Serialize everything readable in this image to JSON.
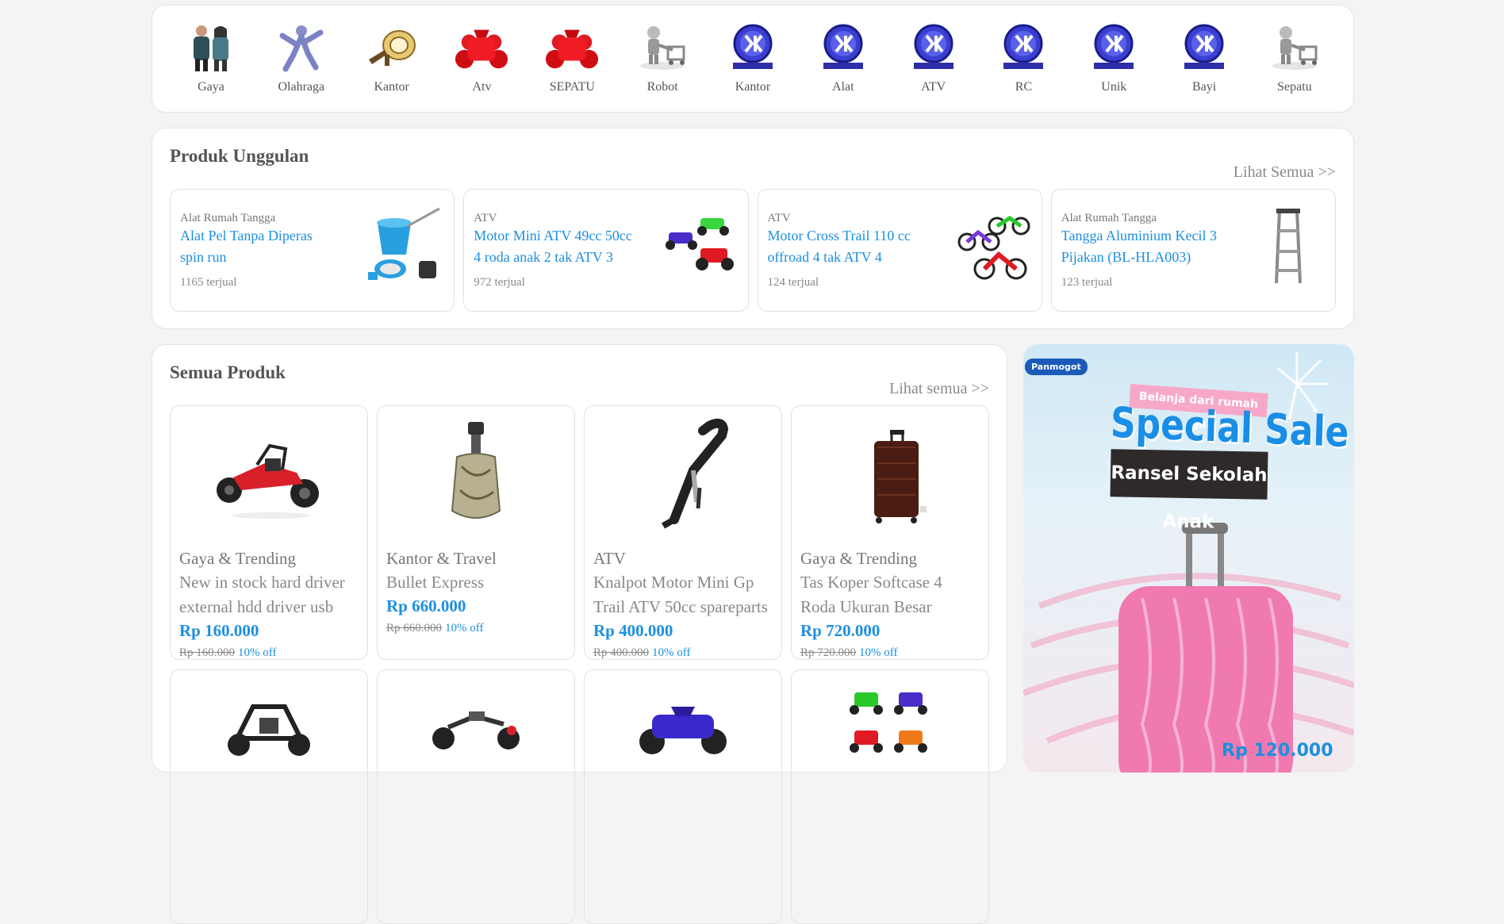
{
  "categories": [
    {
      "label": "Gaya",
      "icon": "people-icon"
    },
    {
      "label": "Olahraga",
      "icon": "athlete-icon"
    },
    {
      "label": "Kantor",
      "icon": "horn-icon"
    },
    {
      "label": "Atv",
      "icon": "atv-icon"
    },
    {
      "label": "SEPATU",
      "icon": "atv-icon"
    },
    {
      "label": "Robot",
      "icon": "robot-cart-icon"
    },
    {
      "label": "Kantor",
      "icon": "brand-logo-icon"
    },
    {
      "label": "Alat",
      "icon": "brand-logo-icon"
    },
    {
      "label": "ATV",
      "icon": "brand-logo-icon"
    },
    {
      "label": "RC",
      "icon": "brand-logo-icon"
    },
    {
      "label": "Unik",
      "icon": "brand-logo-icon"
    },
    {
      "label": "Bayi",
      "icon": "brand-logo-icon"
    },
    {
      "label": "Sepatu",
      "icon": "robot-cart-icon"
    }
  ],
  "featured": {
    "title": "Produk Unggulan",
    "see_all": "Lihat Semua >>",
    "items": [
      {
        "category": "Alat Rumah Tangga",
        "name": "Alat Pel Tanpa Diperas spin run",
        "sold": "1165 terjual"
      },
      {
        "category": "ATV",
        "name": "Motor Mini ATV 49cc 50cc 4 roda anak 2 tak ATV 3",
        "sold": "972 terjual"
      },
      {
        "category": "ATV",
        "name": "Motor Cross Trail 110 cc offroad 4 tak ATV 4",
        "sold": "124 terjual"
      },
      {
        "category": "Alat Rumah Tangga",
        "name": "Tangga Aluminium Kecil 3 Pijakan (BL-HLA003)",
        "sold": "123 terjual"
      }
    ]
  },
  "all_products": {
    "title": "Semua Produk",
    "see_all": "Lihat semua >>",
    "items": [
      {
        "category": "Gaya & Trending",
        "name": "New in stock hard driver external hdd driver usb",
        "price": "Rp 160.000",
        "old_price": "Rp 160.000",
        "discount": "10% off"
      },
      {
        "category": "Kantor & Travel",
        "name": "Bullet Express",
        "price": "Rp 660.000",
        "old_price": "Rp 660.000",
        "discount": "10% off"
      },
      {
        "category": "ATV",
        "name": "Knalpot Motor Mini Gp Trail ATV 50cc spareparts",
        "price": "Rp 400.000",
        "old_price": "Rp 400.000",
        "discount": "10% off"
      },
      {
        "category": "Gaya & Trending",
        "name": "Tas Koper Softcase 4 Roda Ukuran Besar",
        "price": "Rp 720.000",
        "old_price": "Rp 720.000",
        "discount": "10% off"
      }
    ]
  },
  "banner": {
    "logo": "Panmogot",
    "tagline": "Belanja dari rumah aja",
    "headline": "Special Sale",
    "subhead": "Ransel Sekolah Anak",
    "price": "Rp 120.000"
  }
}
